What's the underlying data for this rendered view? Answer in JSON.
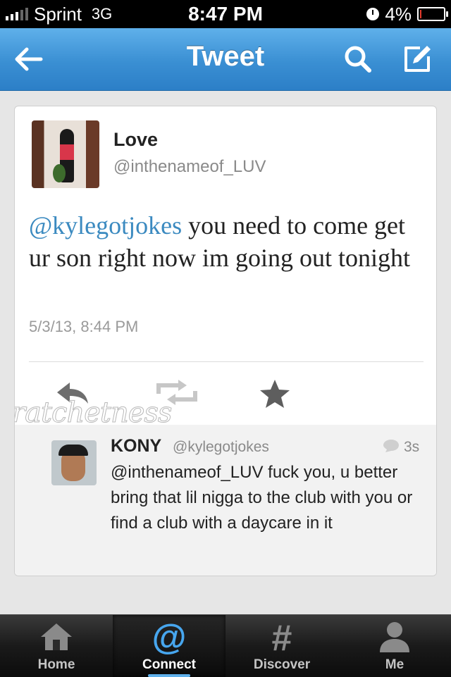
{
  "status_bar": {
    "carrier": "Sprint",
    "network": "3G",
    "time": "8:47 PM",
    "battery": "4%",
    "battery_level": 0.04,
    "signal_icon": "signal-bars-icon",
    "alarm_icon": "clock-icon"
  },
  "nav": {
    "title": "Tweet",
    "back_icon": "back-arrow-icon",
    "search_icon": "search-icon",
    "compose_icon": "compose-icon"
  },
  "tweet": {
    "author_name": "Love",
    "author_handle": "@inthenameof_LUV",
    "mention": "@kylegotjokes",
    "text": " you need to come get ur son right now im going out tonight",
    "date": "5/3/13, 8:44 PM",
    "actions": [
      "reply-icon",
      "retweet-icon",
      "favorite-icon"
    ]
  },
  "watermark": "ratchetness",
  "reply": {
    "name": "KONY",
    "handle": "@kylegotjokes",
    "time": "3s",
    "text": "@inthenameof_LUV fuck you, u better bring that lil nigga to the club with you or find a club with a daycare in it"
  },
  "tabs": [
    {
      "label": "Home",
      "icon": "home-icon"
    },
    {
      "label": "Connect",
      "icon": "at-icon",
      "selected": true
    },
    {
      "label": "Discover",
      "icon": "hashtag-icon"
    },
    {
      "label": "Me",
      "icon": "person-icon"
    }
  ],
  "colors": {
    "nav_blue": "#3a8fd3",
    "mention_blue": "#3b8ac0",
    "battery_red": "#e23a2c"
  }
}
